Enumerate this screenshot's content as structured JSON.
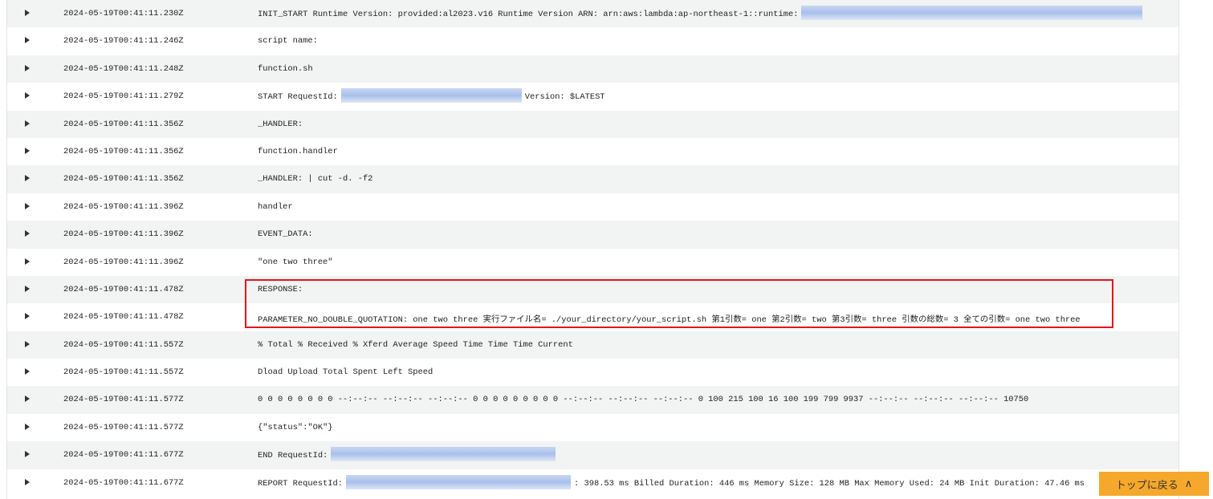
{
  "logs": [
    {
      "ts": "2024-05-19T00:41:11.230Z",
      "msg": "INIT_START Runtime Version: provided:al2023.v16 Runtime Version ARN: arn:aws:lambda:ap-northeast-1::runtime:",
      "after": ""
    },
    {
      "ts": "2024-05-19T00:41:11.246Z",
      "msg": "script name:"
    },
    {
      "ts": "2024-05-19T00:41:11.248Z",
      "msg": "function.sh"
    },
    {
      "ts": "2024-05-19T00:41:11.279Z",
      "msg": "START RequestId:",
      "after": "Version: $LATEST"
    },
    {
      "ts": "2024-05-19T00:41:11.356Z",
      "msg": "_HANDLER:"
    },
    {
      "ts": "2024-05-19T00:41:11.356Z",
      "msg": "function.handler"
    },
    {
      "ts": "2024-05-19T00:41:11.356Z",
      "msg": "_HANDLER: | cut -d. -f2"
    },
    {
      "ts": "2024-05-19T00:41:11.396Z",
      "msg": "handler"
    },
    {
      "ts": "2024-05-19T00:41:11.396Z",
      "msg": "EVENT_DATA:"
    },
    {
      "ts": "2024-05-19T00:41:11.396Z",
      "msg": "\"one two three\""
    },
    {
      "ts": "2024-05-19T00:41:11.478Z",
      "msg": "RESPONSE:"
    },
    {
      "ts": "2024-05-19T00:41:11.478Z",
      "msg": "PARAMETER_NO_DOUBLE_QUOTATION: one two three 実行ファイル名= ./your_directory/your_script.sh 第1引数= one 第2引数= two 第3引数= three 引数の総数= 3 全ての引数= one two three"
    },
    {
      "ts": "2024-05-19T00:41:11.557Z",
      "msg": "% Total % Received % Xferd Average Speed Time Time Time Current"
    },
    {
      "ts": "2024-05-19T00:41:11.557Z",
      "msg": "Dload Upload Total Spent Left Speed"
    },
    {
      "ts": "2024-05-19T00:41:11.577Z",
      "msg": "0 0 0 0 0 0 0 0 --:--:-- --:--:-- --:--:-- 0 0 0 0 0 0 0 0 0 --:--:-- --:--:-- --:--:-- 0 100 215 100 16 100 199 799 9937 --:--:-- --:--:-- --:--:-- 10750"
    },
    {
      "ts": "2024-05-19T00:41:11.577Z",
      "msg": "{\"status\":\"OK\"}"
    },
    {
      "ts": "2024-05-19T00:41:11.677Z",
      "msg": "END RequestId:",
      "after": ""
    },
    {
      "ts": "2024-05-19T00:41:11.677Z",
      "msg": "REPORT RequestId:",
      "after": ": 398.53 ms Billed Duration: 446 ms Memory Size: 128 MB Max Memory Used: 24 MB Init Duration: 47.46 ms"
    }
  ],
  "back_to_top": "トップに戻る",
  "back_to_top_icon": "chevron-up-icon",
  "highlight_color": "#e8141a",
  "button_color": "#f5a82b"
}
